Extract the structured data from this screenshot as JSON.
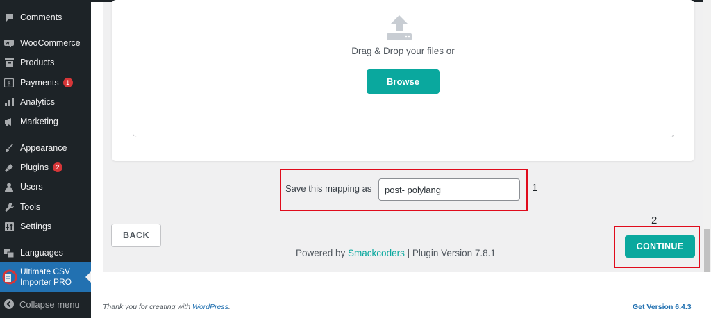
{
  "sidebar": {
    "items": [
      {
        "key": "comments",
        "label": "Comments",
        "icon": "comment-icon"
      },
      {
        "key": "woocommerce",
        "label": "WooCommerce",
        "icon": "woo-icon"
      },
      {
        "key": "products",
        "label": "Products",
        "icon": "archive-icon"
      },
      {
        "key": "payments",
        "label": "Payments",
        "icon": "dollar-icon",
        "badge": "1"
      },
      {
        "key": "analytics",
        "label": "Analytics",
        "icon": "bar-chart-icon"
      },
      {
        "key": "marketing",
        "label": "Marketing",
        "icon": "megaphone-icon"
      },
      {
        "key": "appearance",
        "label": "Appearance",
        "icon": "paintbrush-icon"
      },
      {
        "key": "plugins",
        "label": "Plugins",
        "icon": "plug-icon",
        "badge": "2"
      },
      {
        "key": "users",
        "label": "Users",
        "icon": "user-icon"
      },
      {
        "key": "tools",
        "label": "Tools",
        "icon": "wrench-icon"
      },
      {
        "key": "settings",
        "label": "Settings",
        "icon": "sliders-icon"
      },
      {
        "key": "languages",
        "label": "Languages",
        "icon": "translate-icon"
      }
    ],
    "active": {
      "label_line1": "Ultimate CSV",
      "label_line2": "Importer PRO",
      "icon": "csv-importer-icon"
    },
    "collapse_label": "Collapse menu"
  },
  "upload": {
    "drop_text": "Drag & Drop your files or",
    "browse_label": "Browse"
  },
  "mapping": {
    "label": "Save this mapping as",
    "value": "post- polylang",
    "annotation": "1"
  },
  "actions": {
    "back_label": "BACK",
    "continue_label": "CONTINUE",
    "continue_annotation": "2"
  },
  "powered": {
    "prefix": "Powered by ",
    "link": "Smackcoders",
    "suffix": " | Plugin Version 7.8.1"
  },
  "footer": {
    "thanks_prefix": "Thank you for creating with ",
    "thanks_link": "WordPress",
    "thanks_suffix": ".",
    "version": "Get Version 6.4.3"
  },
  "colors": {
    "accent": "#0aa89e",
    "sidebar_bg": "#1d2327",
    "sidebar_active": "#2271b1",
    "annotation_red": "#e00b1c",
    "badge_red": "#d63638"
  }
}
